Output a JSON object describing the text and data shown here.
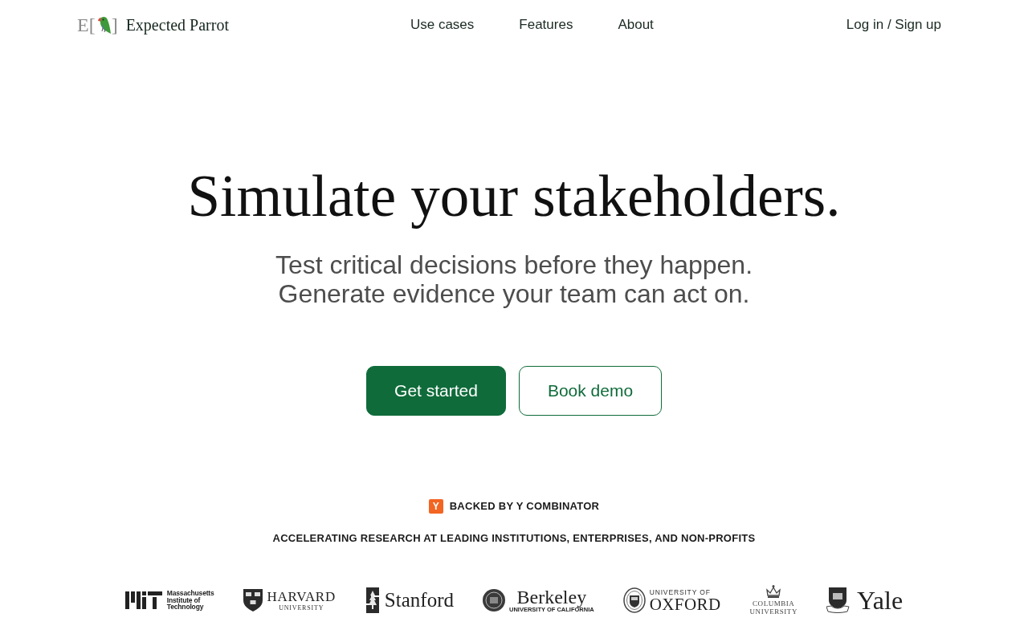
{
  "header": {
    "brand": {
      "mark_left": "E[",
      "mark_right": "]",
      "name": "Expected Parrot"
    },
    "nav": [
      {
        "label": "Use cases"
      },
      {
        "label": "Features"
      },
      {
        "label": "About"
      }
    ],
    "login": "Log in / Sign up"
  },
  "hero": {
    "title": "Simulate your stakeholders.",
    "subtitle_lines": [
      "Test critical decisions before they happen.",
      "Generate evidence your team can act on."
    ],
    "buttons": [
      {
        "label": "Get started",
        "kind": "primary"
      },
      {
        "label": "Book demo",
        "kind": "secondary"
      }
    ]
  },
  "backing": {
    "badge": "Y",
    "text": "BACKED BY Y COMBINATOR"
  },
  "institutions": {
    "heading": "ACCELERATING RESEARCH AT LEADING INSTITUTIONS, ENTERPRISES, AND NON-PROFITS",
    "logos": [
      {
        "kind": "mit",
        "lines": [
          "Massachusetts",
          "Institute of",
          "Technology"
        ]
      },
      {
        "kind": "harvard",
        "lines": [
          "HARVARD",
          "UNIVERSITY"
        ]
      },
      {
        "kind": "stanford",
        "lines": [
          "Stanford"
        ]
      },
      {
        "kind": "berkeley",
        "lines": [
          "Berkeley",
          "UNIVERSITY OF CALIFORNIA"
        ]
      },
      {
        "kind": "oxford",
        "lines": [
          "UNIVERSITY OF",
          "OXFORD"
        ]
      },
      {
        "kind": "columbia",
        "lines": [
          "COLUMBIA",
          "UNIVERSITY"
        ]
      },
      {
        "kind": "yale",
        "lines": [
          "Yale"
        ]
      }
    ]
  }
}
